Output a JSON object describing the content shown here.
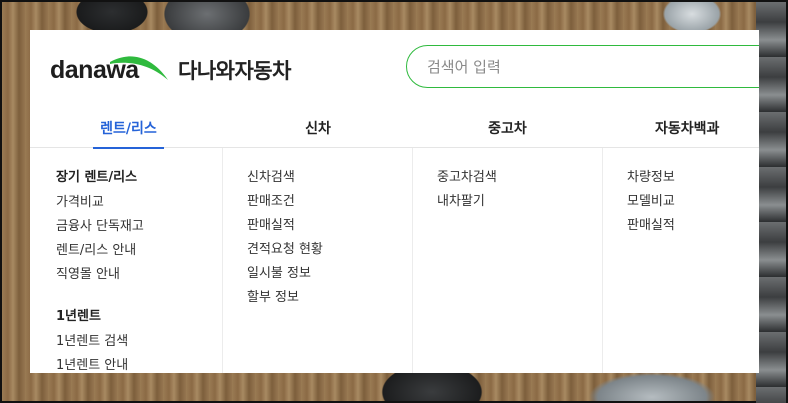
{
  "brand": {
    "logo_text": "danawa",
    "name_ko": "다나와자동차",
    "accent_color": "#2fba3e"
  },
  "search": {
    "placeholder": "검색어 입력",
    "value": ""
  },
  "tabs": [
    {
      "label": "렌트/리스",
      "active": true
    },
    {
      "label": "신차",
      "active": false
    },
    {
      "label": "중고차",
      "active": false
    },
    {
      "label": "자동차백과",
      "active": false
    }
  ],
  "menu": {
    "rent": {
      "group1_title": "장기 렌트/리스",
      "group1_items": [
        "가격비교",
        "금융사 단독재고",
        "렌트/리스 안내",
        "직영몰 안내"
      ],
      "group2_title": "1년렌트",
      "group2_items": [
        "1년렌트 검색",
        "1년렌트 안내"
      ]
    },
    "new": {
      "items": [
        "신차검색",
        "판매조건",
        "판매실적",
        "견적요청 현황",
        "일시불 정보",
        "할부 정보"
      ]
    },
    "used": {
      "items": [
        "중고차검색",
        "내차팔기"
      ]
    },
    "encyclopedia": {
      "items": [
        "차량정보",
        "모델비교",
        "판매실적"
      ]
    }
  },
  "colors": {
    "active_tab": "#2563d8",
    "text": "#222222",
    "divider": "#e5e5e5"
  }
}
